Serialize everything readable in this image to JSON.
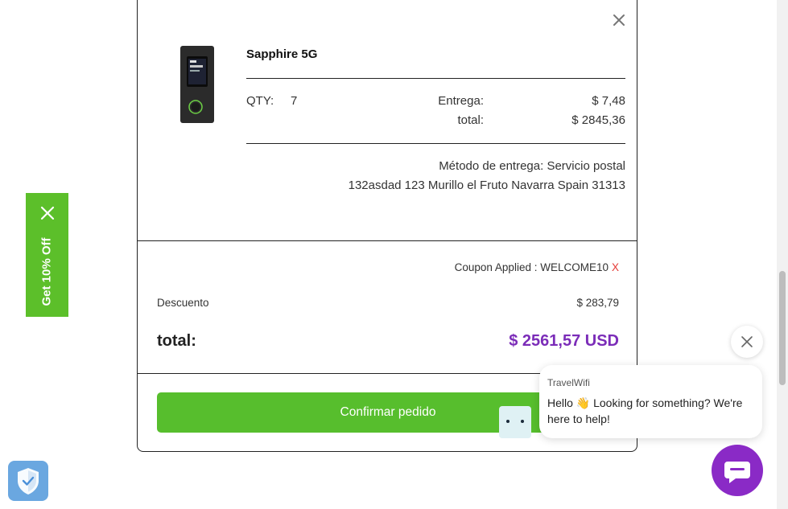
{
  "order": {
    "product_name": "Sapphire 5G",
    "qty_label": "QTY:",
    "qty_value": "7",
    "delivery_label": "Entrega:",
    "delivery_value": "$ 7,48",
    "subtotal_label": "total:",
    "subtotal_value": "$ 2845,36",
    "shipping_method": "Método de entrega: Servicio postal",
    "shipping_address": "132asdad 123 Murillo el Fruto Navarra Spain 31313"
  },
  "summary": {
    "coupon_text": "Coupon Applied : WELCOME10",
    "coupon_remove": "X",
    "discount_label": "Descuento",
    "discount_value": "$ 283,79",
    "total_label": "total:",
    "total_value": "$ 2561,57 USD",
    "confirm_label": "Confirmar pedido"
  },
  "promo": {
    "label": "Get 10% Off"
  },
  "chat": {
    "brand": "TravelWifi",
    "message": "Hello 👋 Looking for something? We're here to help!"
  },
  "icons": {
    "close": "close-icon",
    "shield": "shield-icon",
    "chat": "chat-icon",
    "bot": "bot-avatar-icon"
  },
  "colors": {
    "accent_green": "#57be2d",
    "total_purple": "#7b2cb8",
    "chat_purple": "#8a2ac6",
    "coupon_remove_red": "#e53935",
    "promo_green": "#5cbf2a",
    "shield_blue": "#6aa7e0"
  }
}
